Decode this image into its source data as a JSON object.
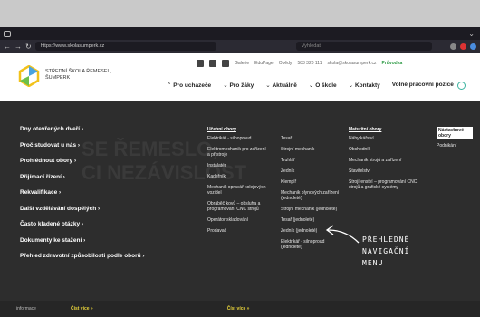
{
  "browser": {
    "url": "https://www.skolasumperk.cz",
    "search_placeholder": "Vyhledat"
  },
  "site": {
    "brand_line1": "Střední škola řemesel,",
    "brand_line2": "Šumperk",
    "utility": {
      "galerie": "Galerie",
      "edupage": "EduPage",
      "obedy": "Obědy",
      "phone": "583 320 111",
      "email": "skola@skolasumperk.cz",
      "pruvodka": "Průvodka"
    },
    "nav": [
      {
        "label": "Pro uchazeče"
      },
      {
        "label": "Pro žáky"
      },
      {
        "label": "Aktuálně"
      },
      {
        "label": "O škole"
      },
      {
        "label": "Kontakty"
      },
      {
        "label": "Volné pracovní pozice"
      }
    ]
  },
  "mega": {
    "left_links": [
      "Dny otevřených dveří ›",
      "Proč studovat u nás ›",
      "Prohlédnout obory ›",
      "Přijímací řízení ›",
      "Rekvalifikace ›",
      "Další vzdělávání dospělých ›",
      "Často kladené otázky ›",
      "Dokumenty ke stažení ›",
      "Přehled zdravotní způsobilosti podle oborů ›"
    ],
    "ucebni_heading": "Učební obory",
    "ucebni_col1": [
      "Elektrikář - silnoproud",
      "Elektromechanik pro zařízení a přístroje",
      "Instalatér",
      "Kadeřník",
      "Mechanik opravář kolejových vozidel",
      "Obráběč kovů – obsluha a programování CNC strojů",
      "Operátor skladování",
      "Prodavač"
    ],
    "ucebni_col2": [
      "Tesař",
      "Strojní mechanik",
      "Truhlář",
      "Zedník",
      "Klempíř",
      "Mechanik plynových zařízení (jednoleté)",
      "Strojní mechanik (jednoleté)",
      "Tesař (jednoleté)",
      "Zedník (jednoleté)",
      "Elektrikář - silnoproud (jednoleté)"
    ],
    "maturitni_heading": "Maturitní obory",
    "maturitni": [
      "Nábytkářství",
      "Obchodník",
      "Mechanik strojů a zařízení",
      "Stavitelství",
      "Strojírenství – programování CNC strojů a grafické systémy"
    ],
    "nastavbove_heading": "Nástavbové obory",
    "nastavbove": [
      "Podnikání"
    ],
    "annotation": [
      "PŘEHLEDNÉ",
      "NAVIGAČNÍ",
      "MENU"
    ],
    "ghost_text": "SE ŘEMESLO,\nCI NEZÁVISLOST"
  },
  "footer": {
    "informace": "informace",
    "cist1": "Číst více »",
    "cist2": "Číst více »"
  }
}
